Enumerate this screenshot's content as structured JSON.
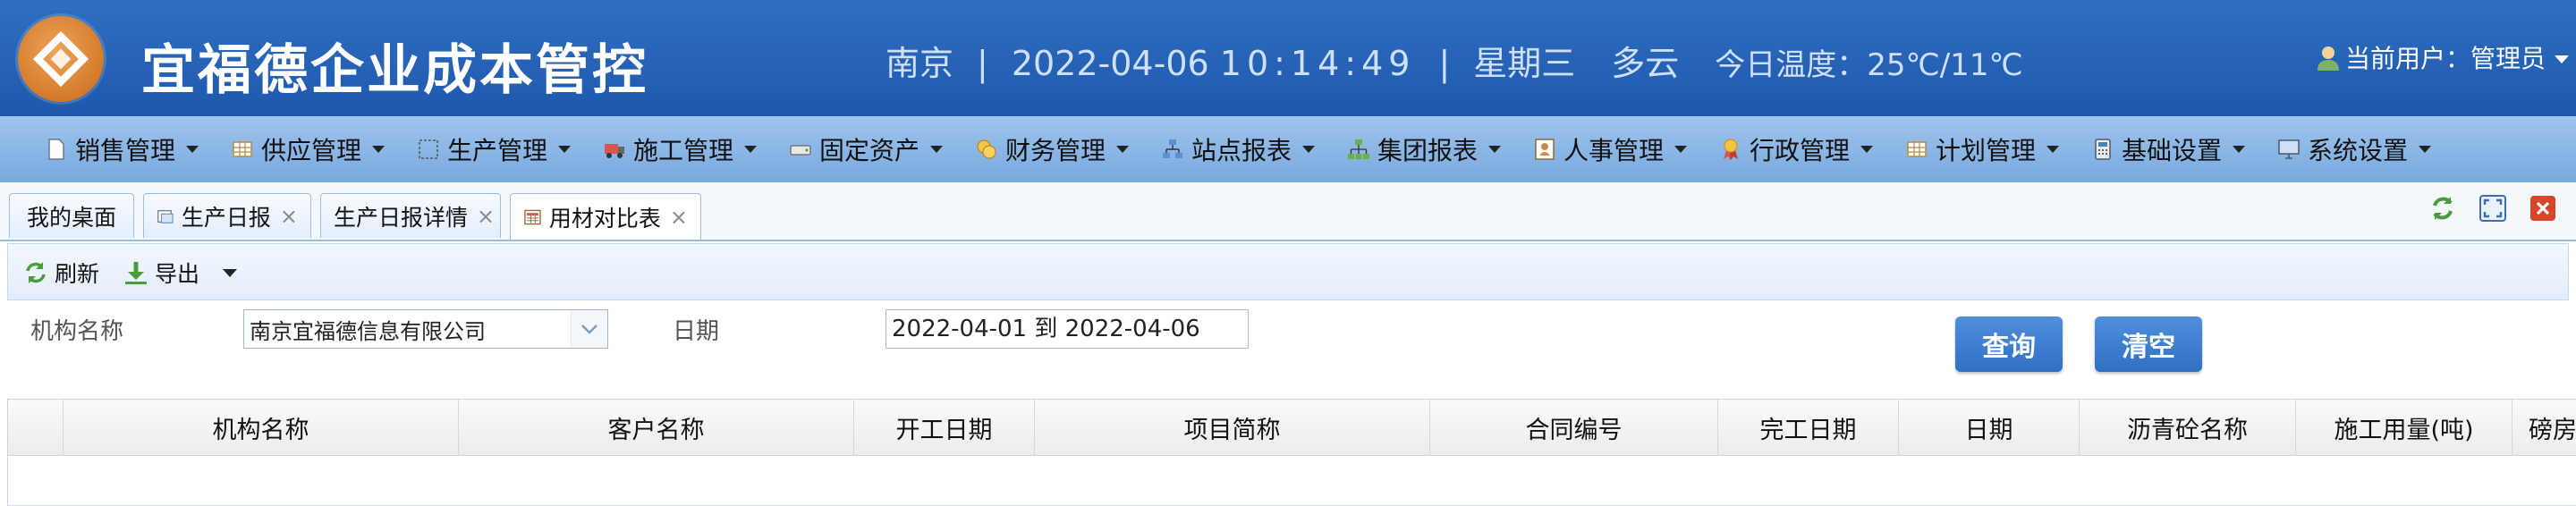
{
  "header": {
    "title": "宜福德企业成本管控",
    "city": "南京",
    "date": "2022-04-06",
    "time": "10:14:49",
    "weekday": "星期三",
    "weather": "多云",
    "temperature": "今日温度：25℃/11℃",
    "user": "当前用户：管理员"
  },
  "menu": [
    {
      "label": "销售管理",
      "icon": "document-icon"
    },
    {
      "label": "供应管理",
      "icon": "grid-icon"
    },
    {
      "label": "生产管理",
      "icon": "select-icon"
    },
    {
      "label": "施工管理",
      "icon": "truck-icon"
    },
    {
      "label": "固定资产",
      "icon": "drive-icon"
    },
    {
      "label": "财务管理",
      "icon": "coins-icon"
    },
    {
      "label": "站点报表",
      "icon": "sitemap-icon"
    },
    {
      "label": "集团报表",
      "icon": "org-chart-icon"
    },
    {
      "label": "人事管理",
      "icon": "id-card-icon"
    },
    {
      "label": "行政管理",
      "icon": "award-icon"
    },
    {
      "label": "计划管理",
      "icon": "table-icon"
    },
    {
      "label": "基础设置",
      "icon": "calculator-icon"
    },
    {
      "label": "系统设置",
      "icon": "monitor-icon"
    }
  ],
  "tabs": [
    {
      "label": "我的桌面",
      "closable": false
    },
    {
      "label": "生产日报",
      "closable": true,
      "icon": "report-icon"
    },
    {
      "label": "生产日报详情",
      "closable": true
    },
    {
      "label": "用材对比表",
      "closable": true,
      "icon": "report-table-icon",
      "active": true
    }
  ],
  "tab_close_glyph": "×",
  "toolbar": {
    "refresh": "刷新",
    "export": "导出"
  },
  "form": {
    "org_label": "机构名称",
    "org_value": "南京宜福德信息有限公司",
    "date_label": "日期",
    "date_value": "2022-04-01 到 2022-04-06",
    "query_button": "查询",
    "clear_button": "清空"
  },
  "grid": {
    "columns": [
      "机构名称",
      "客户名称",
      "开工日期",
      "项目简称",
      "合同编号",
      "完工日期",
      "日期",
      "沥青砼名称",
      "施工用量(吨)",
      "磅房"
    ]
  },
  "colors": {
    "header_bg": "#1e58ad",
    "menubar_bg": "#8bb7e6",
    "primary_button": "#3a7bd0"
  }
}
